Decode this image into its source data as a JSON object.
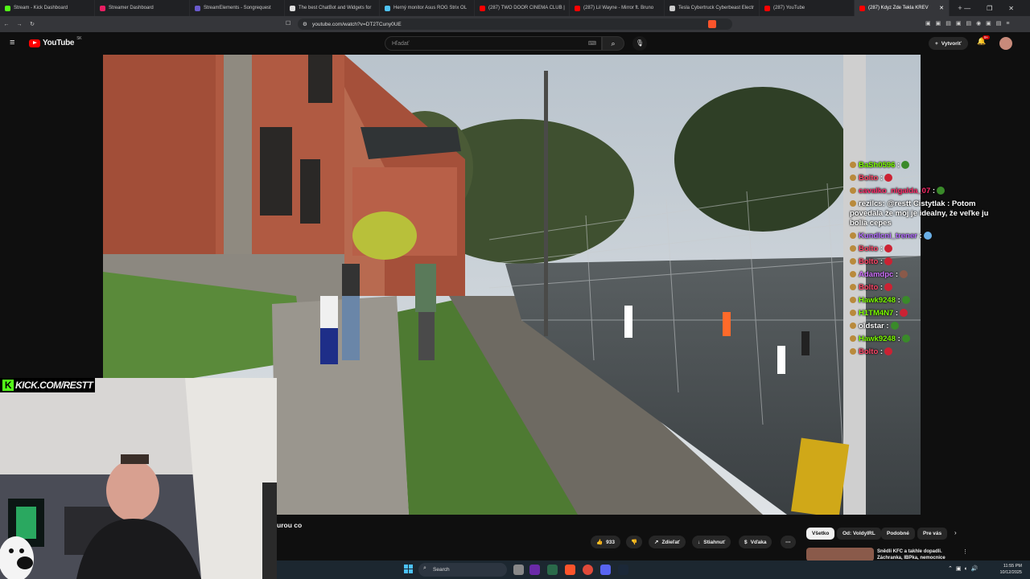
{
  "browser": {
    "tabs": [
      {
        "label": "Stream - Kick Dashboard",
        "color": "#53fc18"
      },
      {
        "label": "Streamer Dashboard",
        "color": "#e91e63"
      },
      {
        "label": "StreamElements - Songrequest",
        "color": "#6a5acd"
      },
      {
        "label": "The best ChatBot and Widgets for",
        "color": "#dddddd"
      },
      {
        "label": "Herný monitor Asus ROG Strix OL",
        "color": "#4fc3f7"
      },
      {
        "label": "(287) TWO DOOR CINEMA CLUB |",
        "color": "#ff0000"
      },
      {
        "label": "(287) Lil Wayne - Mirror ft. Bruno",
        "color": "#ff0000"
      },
      {
        "label": "Tesla Cybertruck Cyberbeast Electr",
        "color": "#cccccc"
      },
      {
        "label": "(287) YouTube",
        "color": "#ff0000"
      },
      {
        "label": "(287) Kdyz Zde Tekla KREV",
        "color": "#ff0000",
        "active": true
      }
    ],
    "url": "youtube.com/watch?v=DT2TCuny0UE",
    "new_tab": "+",
    "window_controls": {
      "minimize": "—",
      "maximize": "❐",
      "close": "✕"
    }
  },
  "youtube": {
    "logo": "YouTube",
    "region": "SK",
    "search_placeholder": "Hľadať",
    "create_label": "Vytvoriť",
    "notifications_badge": "9+"
  },
  "chat": [
    {
      "user": "BaSh0596",
      "color": "#7cfc00",
      "text": "",
      "emote": "#3a8a2a"
    },
    {
      "user": "Bolto",
      "color": "#ff4466",
      "text": "",
      "emote": "#cc2233"
    },
    {
      "user": "cavalko_nigalda_07",
      "color": "#ff2a6a",
      "text": "",
      "emote": "#3a8a2a"
    },
    {
      "user": "rezilcs",
      "color": "#ffffff",
      "text": ": @restt Cistytlak : Potom povedala že moj je idealny, že veľke ju bolia cepes",
      "emote": ""
    },
    {
      "user": "Kundlcni_trener",
      "color": "#b36bff",
      "text": "",
      "emote": "#6ab0e8"
    },
    {
      "user": "Bolto",
      "color": "#ff4466",
      "text": "",
      "emote": "#cc2233"
    },
    {
      "user": "Bolto",
      "color": "#ff4466",
      "text": "",
      "emote": "#cc2233"
    },
    {
      "user": "Adamdpc",
      "color": "#d070ff",
      "text": "",
      "emote": "#8a5a4a"
    },
    {
      "user": "Bolto",
      "color": "#ff4466",
      "text": "",
      "emote": "#cc2233"
    },
    {
      "user": "Hawk9248",
      "color": "#7cfc00",
      "text": "",
      "emote": "#3a8a2a"
    },
    {
      "user": "H1TM4N7",
      "color": "#7cfc00",
      "text": "",
      "emote": "#cc2233"
    },
    {
      "user": "oldstar",
      "color": "#ffffff",
      "text": "",
      "emote": "#3a8a2a"
    },
    {
      "user": "Hawk9248",
      "color": "#7cfc00",
      "text": "",
      "emote": "#3a8a2a"
    },
    {
      "user": "Bolto",
      "color": "#ff4466",
      "text": "",
      "emote": "#cc2233"
    }
  ],
  "webcam": {
    "kick_url": "KICK.COM/RESTT",
    "kick_letter": "K"
  },
  "below": {
    "title": "urou co",
    "likes": "933",
    "share": "Zdieľať",
    "download": "Stiahnuť",
    "thanks": "Vďaka",
    "more": "⋯",
    "chips": [
      "Všetko",
      "Od: VoldyIRL",
      "Podobné",
      "Pre vás"
    ],
    "rec_title": "Snědli KFC a takhle dopadli. Záchranka, IBPka, nemocnice"
  },
  "taskbar": {
    "search": "Search",
    "time": "11:55 PM",
    "date": "10/12/2025"
  }
}
